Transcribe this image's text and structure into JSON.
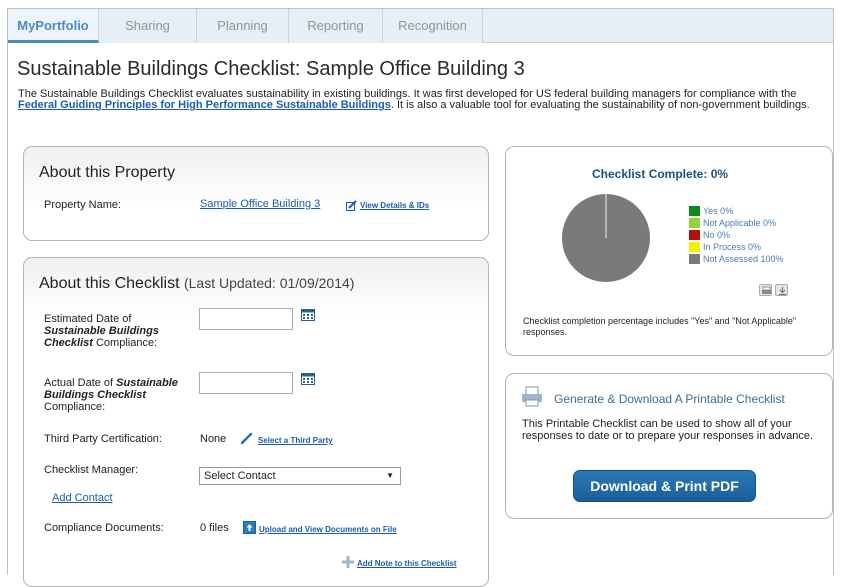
{
  "tabs": [
    {
      "label": "MyPortfolio",
      "active": true
    },
    {
      "label": "Sharing"
    },
    {
      "label": "Planning"
    },
    {
      "label": "Reporting"
    },
    {
      "label": "Recognition"
    }
  ],
  "page": {
    "title": "Sustainable Buildings Checklist: Sample Office Building 3",
    "intro_before": "The Sustainable Buildings Checklist evaluates sustainability in existing buildings. It was first developed for US federal building managers for compliance with the ",
    "intro_link": "Federal Guiding Principles for High Performance Sustainable Buildings",
    "intro_after": ". It is also a valuable tool for evaluating the sustainability of non-government buildings."
  },
  "property_panel": {
    "title": "About this Property",
    "name_label": "Property Name:",
    "name_value": "Sample Office Building 3",
    "details_link": "View Details & IDs"
  },
  "checklist_panel": {
    "title": "About this Checklist",
    "last_updated": "(Last Updated: 01/09/2014)",
    "est_date_label_1": "Estimated Date of",
    "est_date_label_2": "Sustainable Buildings",
    "est_date_label_3": "Checklist",
    "est_date_label_4": " Compliance:",
    "act_date_label_1": "Actual Date of ",
    "act_date_label_2": "Sustainable",
    "act_date_label_3": "Buildings Checklist",
    "act_date_label_4": "Compliance:",
    "estimated_date_value": "",
    "actual_date_value": "",
    "third_party_label": "Third Party Certification:",
    "third_party_value": "None",
    "third_party_link": "Select a Third Party",
    "manager_label": "Checklist Manager:",
    "manager_select": "Select Contact",
    "add_contact": "Add Contact",
    "docs_label": "Compliance Documents:",
    "docs_value": "0 files",
    "docs_link": "Upload and View Documents on File",
    "add_note_link": "Add Note to this Checklist"
  },
  "completion_panel": {
    "title": "Checklist Complete: 0%",
    "legend": [
      {
        "label": "Yes 0%",
        "color": "#0a8a1a"
      },
      {
        "label": "Not Applicable 0%",
        "color": "#8fd43a"
      },
      {
        "label": "No 0%",
        "color": "#b01010"
      },
      {
        "label": "In Process 0%",
        "color": "#f2f200"
      },
      {
        "label": "Not Assessed 100%",
        "color": "#7a7a7a"
      }
    ],
    "note": "Checklist completion percentage includes \"Yes\" and \"Not Applicable\" responses.",
    "print_icon": "printer-icon",
    "download_icon": "download-icon"
  },
  "printable_panel": {
    "title": "Generate & Download A Printable Checklist",
    "description": "This Printable Checklist can be used to show all of your responses to date or to prepare your responses in advance.",
    "button_label": "Download & Print PDF",
    "icon": "printer-icon"
  },
  "chart_data": {
    "type": "pie",
    "categories": [
      "Yes",
      "Not Applicable",
      "No",
      "In Process",
      "Not Assessed"
    ],
    "values": [
      0,
      0,
      0,
      0,
      100
    ],
    "colors": [
      "#0a8a1a",
      "#8fd43a",
      "#b01010",
      "#f2f200",
      "#7a7a7a"
    ],
    "title": "Checklist Complete: 0%",
    "legend": "right"
  }
}
